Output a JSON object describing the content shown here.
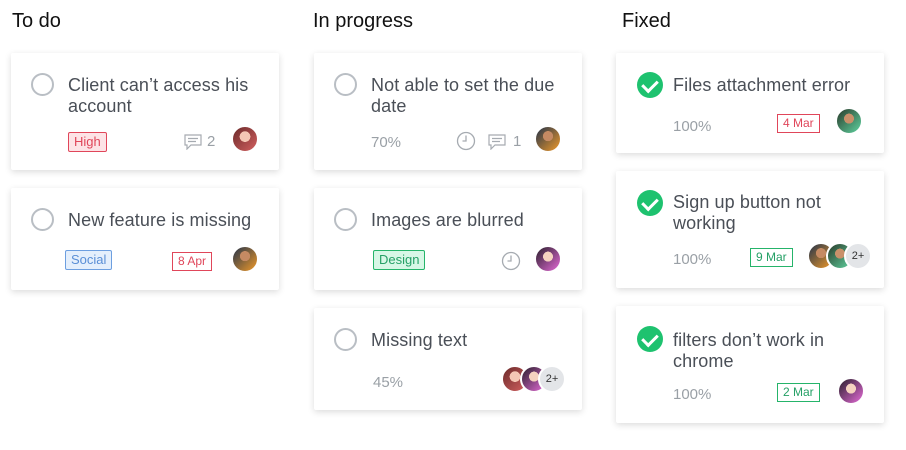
{
  "columns": {
    "todo": {
      "title": "To do",
      "cards": [
        {
          "title": "Client can’t access his account",
          "tag": "High",
          "comments": "2"
        },
        {
          "title": "New feature is missing",
          "tag": "Social",
          "date": "8 Apr"
        }
      ]
    },
    "in_progress": {
      "title": "In progress",
      "cards": [
        {
          "title": "Not able to set the due date",
          "progress": "70%",
          "comments": "1"
        },
        {
          "title": "Images are blurred",
          "tag": "Design"
        },
        {
          "title": "Missing text",
          "progress": "45%",
          "extra_members": "2+"
        }
      ]
    },
    "fixed": {
      "title": "Fixed",
      "cards": [
        {
          "title": "Files attachment error",
          "progress": "100%",
          "date": "4 Mar"
        },
        {
          "title": "Sign up button not working",
          "progress": "100%",
          "date": "9 Mar",
          "extra_members": "2+"
        },
        {
          "title": "filters don’t work in chrome",
          "progress": "100%",
          "date": "2 Mar"
        }
      ]
    }
  },
  "colors": {
    "check": "#1ec26f",
    "danger": "#e0465a",
    "social": "#5a8fd6",
    "success": "#25b46a",
    "text": "#4a4f57",
    "muted": "#9aa0a6"
  },
  "icons": [
    "circle-icon",
    "check-circle-icon",
    "comment-icon",
    "clock-icon",
    "avatar"
  ]
}
